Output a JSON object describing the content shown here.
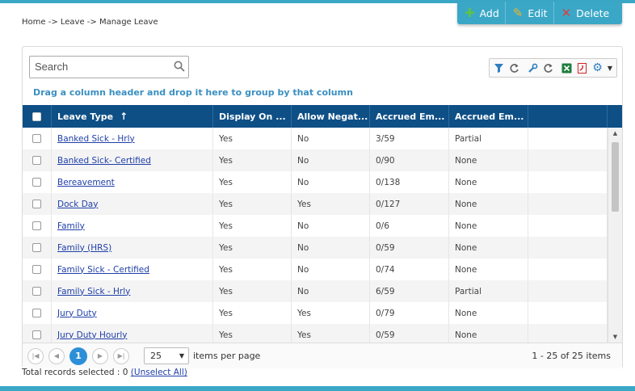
{
  "breadcrumb": "Home -> Leave -> Manage Leave",
  "actions": {
    "add_label": "Add",
    "edit_label": "Edit",
    "delete_label": "Delete"
  },
  "search": {
    "placeholder": "Search"
  },
  "group_hint": "Drag a column header and drop it here to group by that column",
  "columns": [
    "Leave Type",
    "Display On ...",
    "Allow Negat...",
    "Accrued Em...",
    "Accrued Em..."
  ],
  "sort_indicator": "↑",
  "rows": [
    {
      "leave_type": "Banked Sick - Hrly",
      "display_on": "Yes",
      "allow_negative": "No",
      "accrued_1": "3/59",
      "accrued_2": "Partial"
    },
    {
      "leave_type": "Banked Sick- Certified",
      "display_on": "Yes",
      "allow_negative": "No",
      "accrued_1": "0/90",
      "accrued_2": "None"
    },
    {
      "leave_type": "Bereavement",
      "display_on": "Yes",
      "allow_negative": "No",
      "accrued_1": "0/138",
      "accrued_2": "None"
    },
    {
      "leave_type": "Dock Day",
      "display_on": "Yes",
      "allow_negative": "Yes",
      "accrued_1": "0/127",
      "accrued_2": "None"
    },
    {
      "leave_type": "Family",
      "display_on": "Yes",
      "allow_negative": "No",
      "accrued_1": "0/6",
      "accrued_2": "None"
    },
    {
      "leave_type": "Family (HRS)",
      "display_on": "Yes",
      "allow_negative": "No",
      "accrued_1": "0/59",
      "accrued_2": "None"
    },
    {
      "leave_type": "Family Sick - Certified",
      "display_on": "Yes",
      "allow_negative": "No",
      "accrued_1": "0/74",
      "accrued_2": "None"
    },
    {
      "leave_type": "Family Sick - Hrly",
      "display_on": "Yes",
      "allow_negative": "No",
      "accrued_1": "6/59",
      "accrued_2": "Partial"
    },
    {
      "leave_type": "Jury Duty",
      "display_on": "Yes",
      "allow_negative": "Yes",
      "accrued_1": "0/79",
      "accrued_2": "None"
    },
    {
      "leave_type": "Jury Duty Hourly",
      "display_on": "Yes",
      "allow_negative": "Yes",
      "accrued_1": "0/59",
      "accrued_2": "None"
    }
  ],
  "pager": {
    "current_page": "1",
    "page_size": "25",
    "items_per_page_label": "items per page",
    "info": "1 - 25 of 25 items"
  },
  "footer": {
    "total_selected": "Total records selected : 0",
    "unselect_all": "(Unselect All)"
  },
  "toolbar_icons": [
    "filter-icon",
    "refresh-icon",
    "wrench-icon",
    "refresh-icon",
    "excel-icon",
    "pdf-icon",
    "gear-icon",
    "caret-down-icon"
  ],
  "colors": {
    "accent": "#3ba7c6",
    "header": "#0e4f86",
    "link": "#1f3fa8",
    "hint": "#3a8fc1",
    "current_page": "#2c8fd8"
  }
}
